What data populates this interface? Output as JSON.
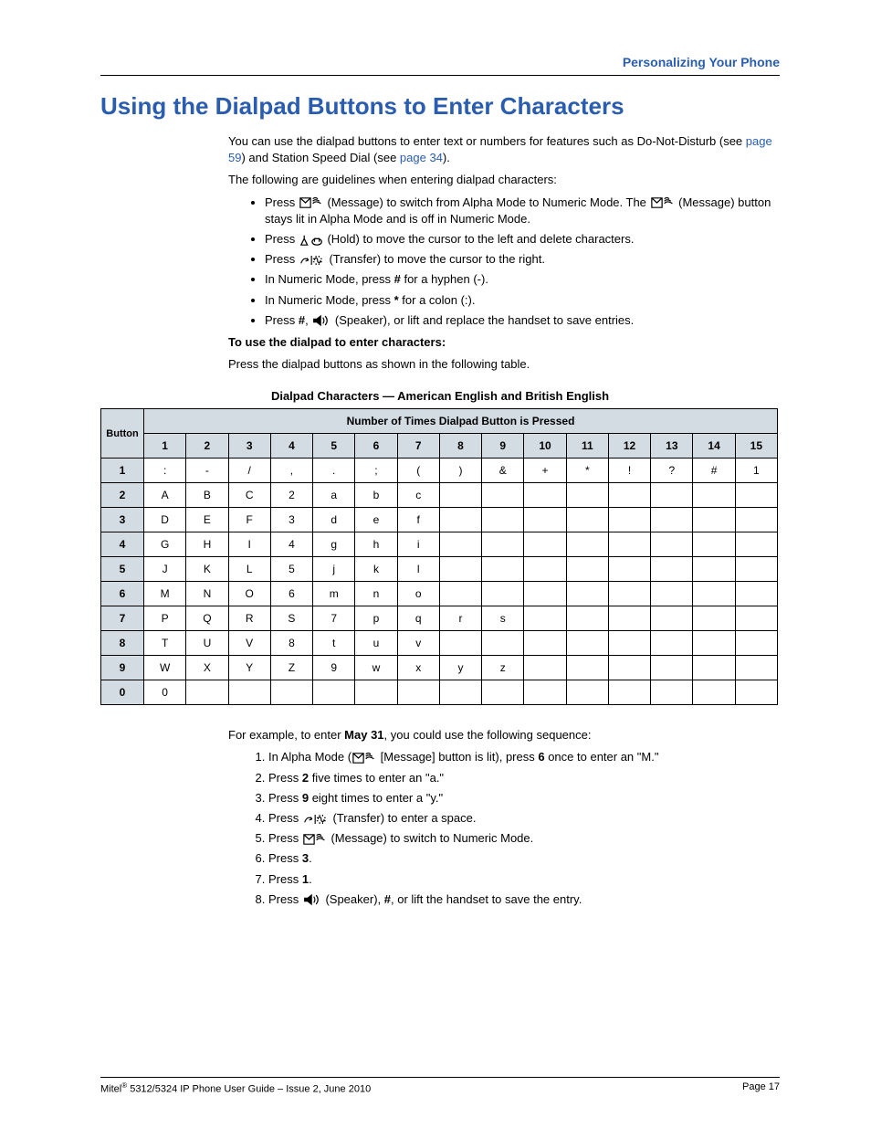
{
  "breadcrumb": "Personalizing Your Phone",
  "title": "Using the Dialpad Buttons to Enter Characters",
  "intro1a": "You can use the dialpad buttons to enter text or numbers for features such as Do-Not-Disturb (see ",
  "intro1link1": "page 59",
  "intro1b": ") and Station Speed Dial (see ",
  "intro1link2": "page 34",
  "intro1c": ").",
  "intro2": "The following are guidelines when entering dialpad characters:",
  "bullets": [
    {
      "pre": "Press ",
      "icon": "message",
      "post": " (Message) to switch from Alpha Mode to Numeric Mode. The ",
      "icon2": "message",
      "post2": " (Message) button stays lit in Alpha Mode and is off in Numeric Mode."
    },
    {
      "pre": "Press ",
      "icon": "hold",
      "post": " (Hold) to move the cursor to the left and delete characters."
    },
    {
      "pre": "Press ",
      "icon": "transfer",
      "post": " (Transfer) to move the cursor to the right."
    },
    {
      "pre": "In Numeric Mode, press ",
      "bold": "#",
      "post": " for a hyphen (-)."
    },
    {
      "pre": "In Numeric Mode, press ",
      "bold": "*",
      "post": " for a colon (:)."
    },
    {
      "pre": "Press ",
      "bold": "#",
      "mid": ", ",
      "icon": "speaker",
      "post": " (Speaker), or lift and replace the handset to save entries."
    }
  ],
  "subhead1": "To use the dialpad to enter characters:",
  "subbody1": "Press the dialpad buttons as shown in the following table.",
  "tablecaption": "Dialpad Characters — American English and British English",
  "table": {
    "spanhead": "Number of Times Dialpad Button is Pressed",
    "btnlabel": "Button",
    "cols": [
      "1",
      "2",
      "3",
      "4",
      "5",
      "6",
      "7",
      "8",
      "9",
      "10",
      "11",
      "12",
      "13",
      "14",
      "15"
    ],
    "rows": [
      {
        "b": "1",
        "c": [
          ":",
          "-",
          "/",
          ",",
          ".",
          ";",
          "(",
          ")",
          "&",
          "+",
          "*",
          "!",
          "?",
          "#",
          "1"
        ]
      },
      {
        "b": "2",
        "c": [
          "A",
          "B",
          "C",
          "2",
          "a",
          "b",
          "c",
          "",
          "",
          "",
          "",
          "",
          "",
          "",
          ""
        ]
      },
      {
        "b": "3",
        "c": [
          "D",
          "E",
          "F",
          "3",
          "d",
          "e",
          "f",
          "",
          "",
          "",
          "",
          "",
          "",
          "",
          ""
        ]
      },
      {
        "b": "4",
        "c": [
          "G",
          "H",
          "I",
          "4",
          "g",
          "h",
          "i",
          "",
          "",
          "",
          "",
          "",
          "",
          "",
          ""
        ]
      },
      {
        "b": "5",
        "c": [
          "J",
          "K",
          "L",
          "5",
          "j",
          "k",
          "l",
          "",
          "",
          "",
          "",
          "",
          "",
          "",
          ""
        ]
      },
      {
        "b": "6",
        "c": [
          "M",
          "N",
          "O",
          "6",
          "m",
          "n",
          "o",
          "",
          "",
          "",
          "",
          "",
          "",
          "",
          ""
        ]
      },
      {
        "b": "7",
        "c": [
          "P",
          "Q",
          "R",
          "S",
          "7",
          "p",
          "q",
          "r",
          "s",
          "",
          "",
          "",
          "",
          "",
          ""
        ]
      },
      {
        "b": "8",
        "c": [
          "T",
          "U",
          "V",
          "8",
          "t",
          "u",
          "v",
          "",
          "",
          "",
          "",
          "",
          "",
          "",
          ""
        ]
      },
      {
        "b": "9",
        "c": [
          "W",
          "X",
          "Y",
          "Z",
          "9",
          "w",
          "x",
          "y",
          "z",
          "",
          "",
          "",
          "",
          "",
          ""
        ]
      },
      {
        "b": "0",
        "c": [
          "0",
          "",
          "",
          "",
          "",
          "",
          "",
          "",
          "",
          "",
          "",
          "",
          "",
          "",
          ""
        ]
      }
    ]
  },
  "example_pre": "For example, to enter ",
  "example_bold": "May 31",
  "example_post": ", you could use the following sequence:",
  "steps": [
    {
      "a": "In Alpha Mode (",
      "icon": "message",
      "b": " [Message] button is lit), press ",
      "bold": "6",
      "c": " once to enter an \"M.\""
    },
    {
      "a": "Press ",
      "bold": "2",
      "c": " five times to enter an \"a.\""
    },
    {
      "a": "Press ",
      "bold": "9",
      "c": " eight times to enter a \"y.\""
    },
    {
      "a": "Press ",
      "icon": "transfer",
      "c": " (Transfer) to enter a space."
    },
    {
      "a": "Press ",
      "icon": "message",
      "c": " (Message) to switch to Numeric Mode."
    },
    {
      "a": "Press ",
      "bold": "3",
      "c": "."
    },
    {
      "a": "Press ",
      "bold": "1",
      "c": "."
    },
    {
      "a": "Press ",
      "icon": "speaker",
      "b": " (Speaker), ",
      "bold": "#",
      "c": ", or lift the handset to save the entry."
    }
  ],
  "footer_left_a": "Mitel",
  "footer_left_b": " 5312/5324 IP Phone User Guide – Issue 2, June 2010",
  "footer_right": "Page 17"
}
